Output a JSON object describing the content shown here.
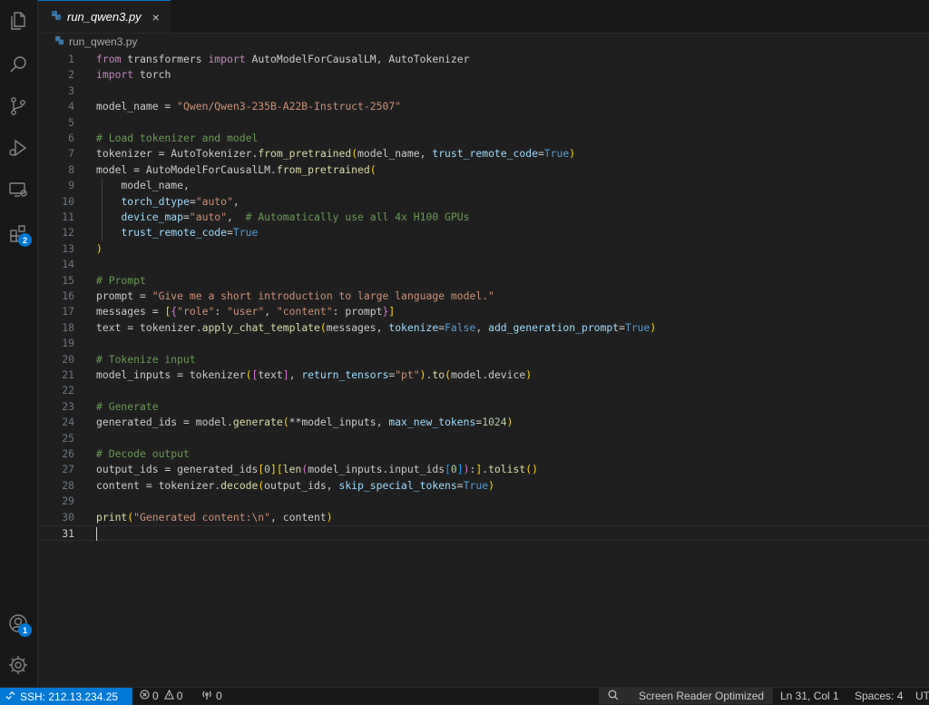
{
  "tab": {
    "label": "run_qwen3.py",
    "close": "×"
  },
  "breadcrumb": {
    "label": "run_qwen3.py"
  },
  "activity_bar": {
    "icons": [
      "explorer-icon",
      "search-icon",
      "source-control-icon",
      "run-debug-icon",
      "remote-explorer-icon",
      "extensions-icon",
      "accounts-icon",
      "settings-icon"
    ],
    "extensions_badge": "2",
    "accounts_badge": "1"
  },
  "editor": {
    "current_line": 31,
    "lines": [
      [
        [
          "kw",
          "from"
        ],
        [
          "id",
          " transformers "
        ],
        [
          "kw",
          "import"
        ],
        [
          "id",
          " AutoModelForCausalLM, AutoTokenizer"
        ]
      ],
      [
        [
          "kw",
          "import"
        ],
        [
          "id",
          " torch"
        ]
      ],
      [],
      [
        [
          "id",
          "model_name = "
        ],
        [
          "str",
          "\"Qwen/Qwen3-235B-A22B-Instruct-2507\""
        ]
      ],
      [],
      [
        [
          "cm",
          "# Load tokenizer and model"
        ]
      ],
      [
        [
          "id",
          "tokenizer = AutoTokenizer."
        ],
        [
          "fn",
          "from_pretrained"
        ],
        [
          "b1",
          "("
        ],
        [
          "id",
          "model_name, "
        ],
        [
          "prm",
          "trust_remote_code"
        ],
        [
          "id",
          "="
        ],
        [
          "bool",
          "True"
        ],
        [
          "b1",
          ")"
        ]
      ],
      [
        [
          "id",
          "model = AutoModelForCausalLM."
        ],
        [
          "fn",
          "from_pretrained"
        ],
        [
          "b1",
          "("
        ]
      ],
      [
        [
          "id",
          "    model_name,"
        ]
      ],
      [
        [
          "id",
          "    "
        ],
        [
          "prm",
          "torch_dtype"
        ],
        [
          "id",
          "="
        ],
        [
          "str",
          "\"auto\""
        ],
        [
          "id",
          ","
        ]
      ],
      [
        [
          "id",
          "    "
        ],
        [
          "prm",
          "device_map"
        ],
        [
          "id",
          "="
        ],
        [
          "str",
          "\"auto\""
        ],
        [
          "id",
          ",  "
        ],
        [
          "cm",
          "# Automatically use all 4x H100 GPUs"
        ]
      ],
      [
        [
          "id",
          "    "
        ],
        [
          "prm",
          "trust_remote_code"
        ],
        [
          "id",
          "="
        ],
        [
          "bool",
          "True"
        ]
      ],
      [
        [
          "b1",
          ")"
        ]
      ],
      [],
      [
        [
          "cm",
          "# Prompt"
        ]
      ],
      [
        [
          "id",
          "prompt = "
        ],
        [
          "str",
          "\"Give me a short introduction to large language model.\""
        ]
      ],
      [
        [
          "id",
          "messages = "
        ],
        [
          "b1",
          "["
        ],
        [
          "b2",
          "{"
        ],
        [
          "str",
          "\"role\""
        ],
        [
          "id",
          ": "
        ],
        [
          "str",
          "\"user\""
        ],
        [
          "id",
          ", "
        ],
        [
          "str",
          "\"content\""
        ],
        [
          "id",
          ": prompt"
        ],
        [
          "b2",
          "}"
        ],
        [
          "b1",
          "]"
        ]
      ],
      [
        [
          "id",
          "text = tokenizer."
        ],
        [
          "fn",
          "apply_chat_template"
        ],
        [
          "b1",
          "("
        ],
        [
          "id",
          "messages, "
        ],
        [
          "prm",
          "tokenize"
        ],
        [
          "id",
          "="
        ],
        [
          "bool",
          "False"
        ],
        [
          "id",
          ", "
        ],
        [
          "prm",
          "add_generation_prompt"
        ],
        [
          "id",
          "="
        ],
        [
          "bool",
          "True"
        ],
        [
          "b1",
          ")"
        ]
      ],
      [],
      [
        [
          "cm",
          "# Tokenize input"
        ]
      ],
      [
        [
          "id",
          "model_inputs = tokenizer"
        ],
        [
          "b1",
          "("
        ],
        [
          "b2",
          "["
        ],
        [
          "id",
          "text"
        ],
        [
          "b2",
          "]"
        ],
        [
          "id",
          ", "
        ],
        [
          "prm",
          "return_tensors"
        ],
        [
          "id",
          "="
        ],
        [
          "str",
          "\"pt\""
        ],
        [
          "b1",
          ")"
        ],
        [
          "id",
          "."
        ],
        [
          "fn",
          "to"
        ],
        [
          "b1",
          "("
        ],
        [
          "id",
          "model.device"
        ],
        [
          "b1",
          ")"
        ]
      ],
      [],
      [
        [
          "cm",
          "# Generate"
        ]
      ],
      [
        [
          "id",
          "generated_ids = model."
        ],
        [
          "fn",
          "generate"
        ],
        [
          "b1",
          "("
        ],
        [
          "id",
          "**model_inputs, "
        ],
        [
          "prm",
          "max_new_tokens"
        ],
        [
          "id",
          "="
        ],
        [
          "num",
          "1024"
        ],
        [
          "b1",
          ")"
        ]
      ],
      [],
      [
        [
          "cm",
          "# Decode output"
        ]
      ],
      [
        [
          "id",
          "output_ids = generated_ids"
        ],
        [
          "b1",
          "["
        ],
        [
          "num",
          "0"
        ],
        [
          "b1",
          "]"
        ],
        [
          "b1",
          "["
        ],
        [
          "fn",
          "len"
        ],
        [
          "b2",
          "("
        ],
        [
          "id",
          "model_inputs.input_ids"
        ],
        [
          "b3",
          "["
        ],
        [
          "num",
          "0"
        ],
        [
          "b3",
          "]"
        ],
        [
          "b2",
          ")"
        ],
        [
          "id",
          ":"
        ],
        [
          "b1",
          "]"
        ],
        [
          "id",
          "."
        ],
        [
          "fn",
          "tolist"
        ],
        [
          "b1",
          "()"
        ]
      ],
      [
        [
          "id",
          "content = tokenizer."
        ],
        [
          "fn",
          "decode"
        ],
        [
          "b1",
          "("
        ],
        [
          "id",
          "output_ids, "
        ],
        [
          "prm",
          "skip_special_tokens"
        ],
        [
          "id",
          "="
        ],
        [
          "bool",
          "True"
        ],
        [
          "b1",
          ")"
        ]
      ],
      [],
      [
        [
          "fn",
          "print"
        ],
        [
          "b1",
          "("
        ],
        [
          "str",
          "\"Generated content:\\n\""
        ],
        [
          "id",
          ", content"
        ],
        [
          "b1",
          ")"
        ]
      ],
      []
    ]
  },
  "statusbar": {
    "remote": "SSH: 212.13.234.25",
    "errors": "0",
    "warnings": "0",
    "ports": "0",
    "screen_reader": "Screen Reader Optimized",
    "position": "Ln 31, Col 1",
    "spaces": "Spaces: 4",
    "encoding": "UT"
  }
}
